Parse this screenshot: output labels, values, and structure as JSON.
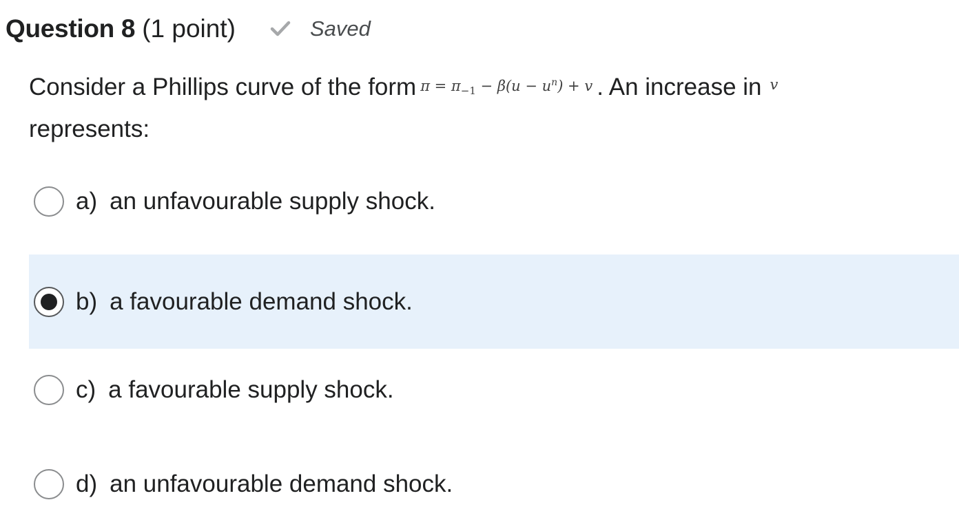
{
  "question": {
    "title": "Question 8",
    "points": "(1 point)",
    "status_icon": "checkmark-icon",
    "status_text": "Saved",
    "stem_before": "Consider a Phillips curve of the form",
    "stem_equation": {
      "lhs": "π = π",
      "lhs_sub": "−1",
      "mid": " − β(u − u",
      "sup": "n",
      "rhs": ") + v"
    },
    "stem_after": ". An increase in",
    "stem_variable": "v",
    "stem_line2": "represents:"
  },
  "options": [
    {
      "letter": "a)",
      "text": "an unfavourable supply shock.",
      "selected": false
    },
    {
      "letter": "b)",
      "text": "a favourable demand shock.",
      "selected": true
    },
    {
      "letter": "c)",
      "text": "a favourable supply shock.",
      "selected": false
    },
    {
      "letter": "d)",
      "text": "an unfavourable demand shock.",
      "selected": false
    }
  ],
  "colors": {
    "selected_background": "#e7f1fb",
    "text": "#202122",
    "check": "#a6a8aa"
  }
}
